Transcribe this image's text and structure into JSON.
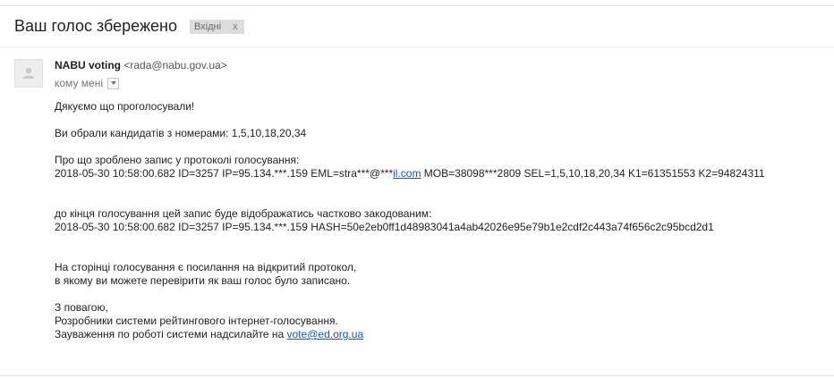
{
  "header": {
    "subject": "Ваш голос збережено",
    "label_chip": {
      "text": "Вхідні",
      "close": "x"
    }
  },
  "message": {
    "avatar_icon": "person-icon",
    "sender": {
      "name": "NABU voting",
      "email": "<rada@nabu.gov.ua>"
    },
    "recipient": "кому мені",
    "body": {
      "thanks": "Дякуємо що проголосували!",
      "candidates": "Ви обрали кандидатів з номерами: 1,5,10,18,20,34",
      "record_intro": "Про що зроблено запис у протоколі голосування:",
      "record_line_prefix": "2018-05-30 10:58:00.682 ID=3257 IP=95.134.***.159 EML=stra***@***",
      "record_line_link": "il.com",
      "record_line_suffix": " MOB=38098***2809 SEL=1,5,10,18,20,34 K1=61351553 K2=94824311",
      "encoded_intro": "до кінця голосування цей запис буде відображатись частково закодованим:",
      "encoded_line": "2018-05-30 10:58:00.682 ID=3257 IP=95.134.***.159 HASH=50e2eb0ff1d48983041a4ab42026e95e79b1e2cdf2c443a74f656c2c95bcd2d1",
      "protocol_line1": "На сторінці голосування є посилання на відкритий протокол,",
      "protocol_line2": "в якому ви можете перевірити як ваш голос було записано.",
      "regards": "З повагою,",
      "team": "Розробники системи рейтингового інтернет-голосування.",
      "feedback_prefix": "Зауваження по роботі системи надсилайте на ",
      "feedback_link": "vote@ed.org.ua"
    }
  },
  "colors": {
    "link": "#1155cc",
    "chip_bg": "#dddddd"
  }
}
